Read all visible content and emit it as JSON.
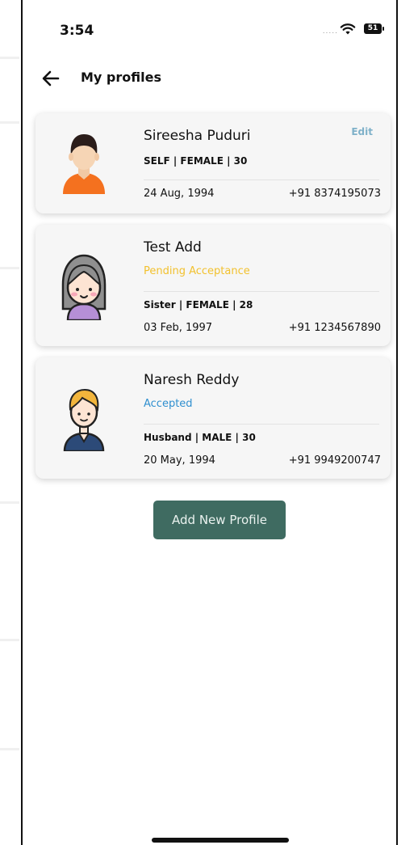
{
  "status_bar": {
    "time": "3:54",
    "signal": ".....",
    "battery": "51"
  },
  "header": {
    "title": "My profiles",
    "back_icon": "arrow-left-icon"
  },
  "colors": {
    "accent": "#3f6b61",
    "pending": "#f2c12e",
    "accepted": "#2f8fcf",
    "edit": "#7fb1c9",
    "card_bg": "#f6f6f6"
  },
  "profiles": [
    {
      "name": "Sireesha Puduri",
      "info": "SELF | FEMALE | 30",
      "edit_label": "Edit",
      "dob": "24 Aug, 1994",
      "phone": "+91 8374195073",
      "avatar_icon": "female-orange-avatar-icon"
    },
    {
      "name": "Test Add",
      "status": "Pending Acceptance",
      "info": "Sister | FEMALE | 28",
      "dob": "03 Feb, 1997",
      "phone": "+91 1234567890",
      "avatar_icon": "girl-avatar-icon"
    },
    {
      "name": "Naresh  Reddy",
      "status": "Accepted",
      "info": "Husband | MALE | 30",
      "dob": "20 May, 1994",
      "phone": "+91 9949200747",
      "avatar_icon": "male-avatar-icon"
    }
  ],
  "add_button": {
    "label": "Add New Profile"
  }
}
